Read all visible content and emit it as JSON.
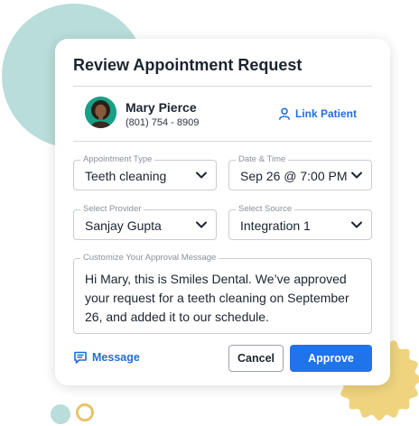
{
  "dialog": {
    "title": "Review Appointment Request"
  },
  "patient": {
    "name": "Mary Pierce",
    "phone": "(801) 754 - 8909",
    "link_label": "Link Patient"
  },
  "fields": {
    "appointment_type": {
      "label": "Appointment Type",
      "value": "Teeth cleaning"
    },
    "date_time": {
      "label": "Date & Time",
      "value": "Sep 26 @ 7:00 PM"
    },
    "provider": {
      "label": "Select Provider",
      "value": "Sanjay Gupta"
    },
    "source": {
      "label": "Select Source",
      "value": "Integration 1"
    }
  },
  "message": {
    "label": "Customize Your Approval Message",
    "text": "Hi Mary, this is Smiles Dental. We’ve approved your request for a teeth cleaning on September 26, and added it to our schedule."
  },
  "footer": {
    "message_label": "Message",
    "cancel_label": "Cancel",
    "approve_label": "Approve"
  },
  "colors": {
    "accent": "#1f73eb",
    "link": "#1f6fd6",
    "decor_teal": "#b9ddda",
    "decor_gold": "#e8c36a"
  }
}
